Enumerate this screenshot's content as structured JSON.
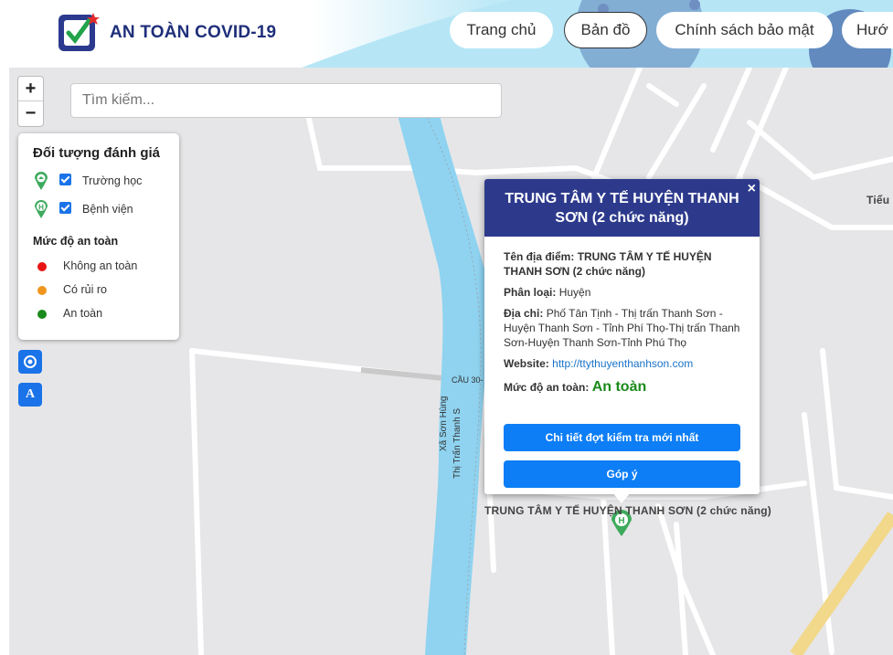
{
  "app": {
    "brand": "AN TOÀN COVID-19",
    "nav": [
      "Trang chủ",
      "Bản đồ",
      "Chính sách bảo mật",
      "Hướ"
    ]
  },
  "map": {
    "zoom_in": "+",
    "zoom_out": "−",
    "search_placeholder": "Tìm kiếm...",
    "locate_icon": "target-icon",
    "font_icon": "A",
    "labels": {
      "bridge": "CẦU 30-",
      "road1": "Xã Sơn Hùng",
      "road2": "Thị Trấn Thanh S",
      "tieu": "Tiểu",
      "marker_label": "TRUNG TÂM Y TẾ HUYỆN THANH SƠN (2 chức năng)"
    }
  },
  "legend": {
    "title": "Đối tượng đánh giá",
    "objects": [
      {
        "label": "Trường học",
        "icon": "school-pin-icon",
        "checked": true
      },
      {
        "label": "Bệnh viện",
        "icon": "hospital-pin-icon",
        "checked": true
      }
    ],
    "safety_title": "Mức độ an toàn",
    "levels": [
      {
        "label": "Không an toàn",
        "color": "#e81313"
      },
      {
        "label": "Có rủi ro",
        "color": "#f0961e"
      },
      {
        "label": "An toàn",
        "color": "#1a8a1a"
      }
    ]
  },
  "popup": {
    "title": "TRUNG TÂM Y TẾ HUYỆN THANH SƠN (2 chức năng)",
    "close": "×",
    "name_label": "Tên địa điểm:",
    "name_value": "TRUNG TÂM Y TẾ HUYỆN THANH SƠN (2 chức năng)",
    "type_label": "Phân loại:",
    "type_value": "Huyện",
    "address_label": "Địa chỉ:",
    "address_value": "Phố Tân Tịnh - Thị trấn Thanh Sơn - Huyện Thanh Sơn - Tỉnh Phí Thọ-Thị trấn Thanh Sơn-Huyện Thanh Sơn-Tỉnh Phú Thọ",
    "website_label": "Website:",
    "website_value": "http://ttythuyenthanhson.com",
    "safety_label": "Mức độ an toàn:",
    "safety_value": "An toàn",
    "btn_detail": "Chi tiết đợt kiểm tra mới nhất",
    "btn_feedback": "Góp ý"
  },
  "colors": {
    "header_nav_bg": "#ffffff",
    "popup_header": "#2d3a8c",
    "primary_button": "#0d7ef5",
    "river": "#8fd3f0",
    "safe": "#1a8a1a"
  }
}
